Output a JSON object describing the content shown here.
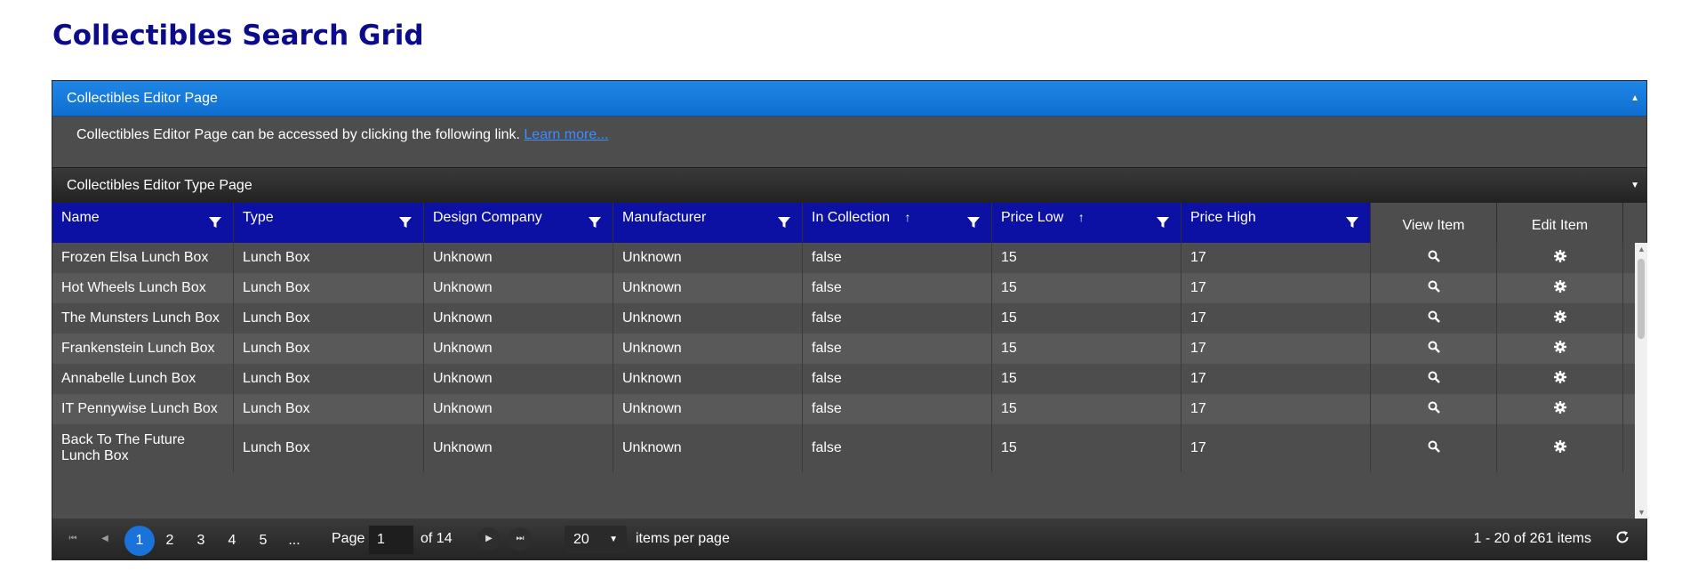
{
  "page_title": "Collectibles Search Grid",
  "panel1": {
    "title": "Collectibles Editor Page",
    "body_text": "Collectibles Editor Page can be accessed by clicking the following link.",
    "link_text": "Learn more..."
  },
  "panel2": {
    "title": "Collectibles Editor Type Page"
  },
  "columns": {
    "name": "Name",
    "type": "Type",
    "design_company": "Design Company",
    "manufacturer": "Manufacturer",
    "in_collection": "In Collection",
    "price_low": "Price Low",
    "price_high": "Price High",
    "view_item": "View Item",
    "edit_item": "Edit Item"
  },
  "sort_icon": "↑",
  "rows": [
    {
      "name": "Frozen Elsa Lunch Box",
      "type": "Lunch Box",
      "design_company": "Unknown",
      "manufacturer": "Unknown",
      "in_collection": "false",
      "price_low": "15",
      "price_high": "17"
    },
    {
      "name": "Hot Wheels Lunch Box",
      "type": "Lunch Box",
      "design_company": "Unknown",
      "manufacturer": "Unknown",
      "in_collection": "false",
      "price_low": "15",
      "price_high": "17"
    },
    {
      "name": "The Munsters Lunch Box",
      "type": "Lunch Box",
      "design_company": "Unknown",
      "manufacturer": "Unknown",
      "in_collection": "false",
      "price_low": "15",
      "price_high": "17"
    },
    {
      "name": "Frankenstein Lunch Box",
      "type": "Lunch Box",
      "design_company": "Unknown",
      "manufacturer": "Unknown",
      "in_collection": "false",
      "price_low": "15",
      "price_high": "17"
    },
    {
      "name": "Annabelle Lunch Box",
      "type": "Lunch Box",
      "design_company": "Unknown",
      "manufacturer": "Unknown",
      "in_collection": "false",
      "price_low": "15",
      "price_high": "17"
    },
    {
      "name": "IT Pennywise Lunch Box",
      "type": "Lunch Box",
      "design_company": "Unknown",
      "manufacturer": "Unknown",
      "in_collection": "false",
      "price_low": "15",
      "price_high": "17"
    },
    {
      "name": "Back To The Future Lunch Box",
      "type": "Lunch Box",
      "design_company": "Unknown",
      "manufacturer": "Unknown",
      "in_collection": "false",
      "price_low": "15",
      "price_high": "17"
    }
  ],
  "pager": {
    "pages": [
      "1",
      "2",
      "3",
      "4",
      "5",
      "..."
    ],
    "current_page": "1",
    "page_label": "Page",
    "of_label": "of 14",
    "page_size": "20",
    "items_per_page_label": "items per page",
    "info": "1 - 20 of 261 items"
  },
  "colors": {
    "accent_blue": "#1f86e6",
    "header_navy": "#0c10a3",
    "title_navy": "#0b0b8c",
    "active_page": "#1a73d9"
  },
  "icons": {
    "view": "search-icon",
    "edit": "gear-icon",
    "filter": "filter-icon",
    "refresh": "refresh-icon"
  }
}
